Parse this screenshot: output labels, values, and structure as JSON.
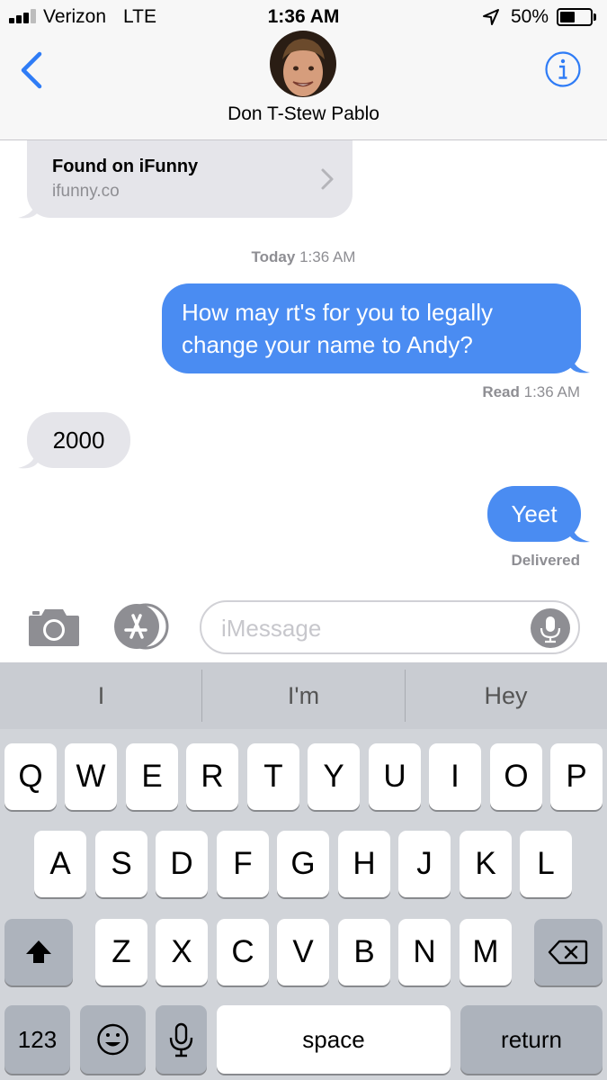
{
  "status_bar": {
    "carrier": "Verizon",
    "network": "LTE",
    "time": "1:36 AM",
    "battery_percent": "50%",
    "battery_level": 0.5,
    "signal_bars": 3,
    "icons": [
      "signal-icon",
      "location-arrow-icon",
      "battery-icon"
    ]
  },
  "header": {
    "contact_name": "Don T-Stew Pablo",
    "icons": [
      "back-chevron-icon",
      "info-icon"
    ]
  },
  "messages": {
    "link_preview": {
      "title": "Found on iFunny",
      "url": "ifunny.co"
    },
    "timestamp": {
      "day": "Today",
      "time": "1:36 AM"
    },
    "outgoing_1": "How may rt's for you to legally change your name to Andy?",
    "read_receipt": {
      "label": "Read",
      "time": "1:36 AM"
    },
    "incoming_1": "2000",
    "outgoing_2": "Yeet",
    "delivered": "Delivered"
  },
  "input_bar": {
    "placeholder": "iMessage",
    "icons": [
      "camera-icon",
      "app-store-icon",
      "microphone-icon"
    ]
  },
  "keyboard": {
    "suggestions": [
      "I",
      "I'm",
      "Hey"
    ],
    "row1": [
      "Q",
      "W",
      "E",
      "R",
      "T",
      "Y",
      "U",
      "I",
      "O",
      "P"
    ],
    "row2": [
      "A",
      "S",
      "D",
      "F",
      "G",
      "H",
      "J",
      "K",
      "L"
    ],
    "row3": [
      "Z",
      "X",
      "C",
      "V",
      "B",
      "N",
      "M"
    ],
    "numbers_key": "123",
    "space_key": "space",
    "return_key": "return",
    "icons": [
      "shift-icon",
      "backspace-icon",
      "emoji-icon",
      "dictation-icon"
    ]
  },
  "colors": {
    "imessage_blue": "#4a8cf2",
    "incoming_gray": "#e5e5ea",
    "accent_blue": "#2f7cf6"
  }
}
